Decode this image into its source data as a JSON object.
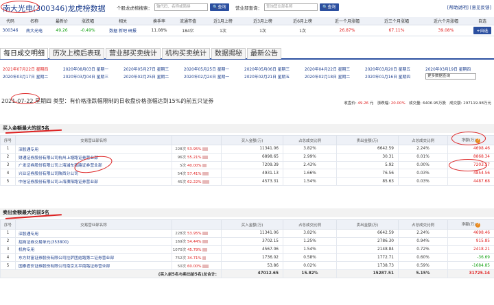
{
  "header": {
    "title": "南大光电(300346)龙虎榜数据",
    "stock_search_label": "个股龙虎榜搜索：",
    "stock_search_placeholder": "输代码、名称或简拼",
    "query_button": "查询",
    "broker_search_label": "营业部查询：",
    "broker_search_placeholder": "查询营业部名称",
    "links": "[帮助说明] [意见反馈]"
  },
  "quote": {
    "columns": [
      "代码",
      "名称",
      "最新价",
      "涨跌幅",
      "相关",
      "换手率",
      "流通市值",
      "近1月上榜",
      "近3月上榜",
      "近6月上榜",
      "近一个月涨幅",
      "近三个月涨幅",
      "近六个月涨幅",
      "自选"
    ],
    "code": "300346",
    "name": "南大光电",
    "price": "49.26",
    "change": "-0.49%",
    "related": "数据 新吧 研报",
    "turnover": "11.08%",
    "float_cap": "184亿",
    "m1": "1次",
    "m3": "1次",
    "m6": "1次",
    "r1": "26.87%",
    "r3": "67.11%",
    "r6": "39.08%",
    "add_label": "+自选"
  },
  "tabs": [
    "每日成交明细",
    "历次上榜后表现",
    "营业部买卖统计",
    "机构买卖统计",
    "数据揭秘",
    "最新公告"
  ],
  "dates": [
    [
      "2021年07月22日 星期四",
      "2020年08月03日 星期一",
      "2020年05月27日 星期三",
      "2020年05月25日 星期一",
      "2020年05月06日 星期三",
      "2020年04月22日 星期三",
      "2020年03月20日 星期五",
      "2020年03月19日 星期四"
    ],
    [
      "2020年03月17日 星期二",
      "2020年03月04日 星期三",
      "2020年02月25日 星期二",
      "2020年02月24日 星期一",
      "2020年02月21日 星期五",
      "2020年02月18日 星期二",
      "2020年01月16日 星期四"
    ]
  ],
  "more_dates": "更多数据查询",
  "headline": "2021-07-22 星期四 类型：有价格涨跌幅限制的日收盘价格涨幅达到15%的前五只证券",
  "summary": {
    "close_label": "收盘价:",
    "close": "49.26",
    "close_unit": "元",
    "chg_label": "涨跌幅:",
    "chg": "20.00%",
    "vol_label": "成交量:",
    "vol": "6406.95万股",
    "amt_label": "成交额:",
    "amt": "297119.98万元"
  },
  "buy_section": {
    "title": "买入金额最大的前5名",
    "columns": [
      "序号",
      "交易营业部名称",
      "",
      "买入金额(万)",
      "占总成交比例",
      "卖出金额(万)",
      "占总成交比例",
      "净额(万)"
    ],
    "rows": [
      [
        "1",
        "深股通专用",
        "228次",
        "53.95%",
        "11341.06",
        "3.82%",
        "6642.59",
        "2.24%",
        "4698.46"
      ],
      [
        "2",
        "财通证券股份有限公司杭州上塘路证券营业部",
        "96次",
        "55.21%",
        "6898.65",
        "2.99%",
        "30.31",
        "0.01%",
        "8868.34"
      ],
      [
        "3",
        "广发证券股份有限公司上海浦东南路证券营业部",
        "5次",
        "40.00%",
        "7209.39",
        "2.43%",
        "5.92",
        "0.00%",
        "7203.57"
      ],
      [
        "4",
        "兴业证券股份有限公司陕西分公司",
        "54次",
        "57.41%",
        "4931.13",
        "1.66%",
        "76.56",
        "0.03%",
        "4854.56"
      ],
      [
        "5",
        "中信证券股份有限公司上海溧阳路证券营业部",
        "45次",
        "62.22%",
        "4573.31",
        "1.54%",
        "85.63",
        "0.03%",
        "4487.68"
      ]
    ]
  },
  "sell_section": {
    "title": "卖出金额最大的前5名",
    "columns": [
      "序号",
      "交易营业部名称",
      "",
      "买入金额(万)",
      "占总成交比例",
      "卖出金额(万)",
      "占总成交比例",
      "净额(万)"
    ],
    "rows": [
      [
        "1",
        "深股通专用",
        "228次",
        "53.95%",
        "11341.06",
        "3.82%",
        "6642.59",
        "2.24%",
        "4698.46"
      ],
      [
        "2",
        "招商证券交易单元(353800)",
        "169次",
        "54.44%",
        "3702.15",
        "1.25%",
        "2786.30",
        "0.94%",
        "915.85"
      ],
      [
        "3",
        "机构专用",
        "1070次",
        "45.79%",
        "4567.06",
        "1.54%",
        "2148.84",
        "0.72%",
        "2418.21"
      ],
      [
        "4",
        "东方财富证券股份有限公司拉萨团结路第二证券营业部",
        "752次",
        "34.71%",
        "1736.02",
        "0.58%",
        "1772.71",
        "0.60%",
        "-36.69"
      ],
      [
        "5",
        "国泰君安证券股份有限公司南京太平南路证券营业部",
        "50次",
        "60.00%",
        "53.86",
        "0.02%",
        "1738.73",
        "0.59%",
        "-1684.85"
      ]
    ],
    "total": [
      "(买入前5名与卖出前5名)总合计:",
      "47012.65",
      "15.82%",
      "15287.51",
      "5.15%",
      "31725.14"
    ]
  },
  "colors": {
    "accent": "#2b4fa0",
    "up": "#e02020",
    "down": "#16a316",
    "annotation": "#dd2222"
  }
}
